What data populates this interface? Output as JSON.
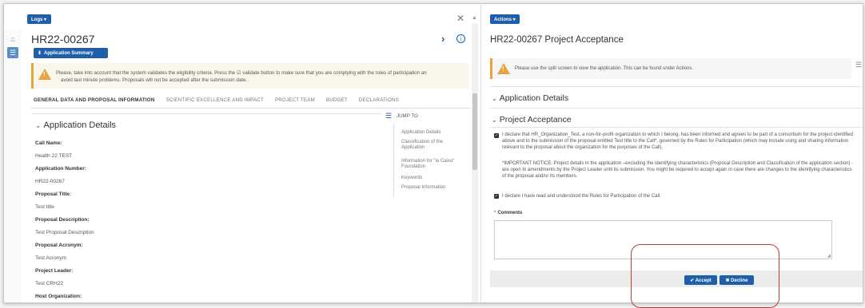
{
  "left": {
    "logs_button": "Logs ▾",
    "title": "HR22-00267",
    "summary_button": "Application Summary",
    "warning_line1": "Please, take into account that the system validates the eligibility criteria. Press the ☑ validate button to make sure that you are complying with the rules of participation an",
    "warning_line2": "avoid last minute problems. Proposals will not be accepted after the submission date.",
    "tabs": [
      {
        "label": "GENERAL DATA AND PROPOSAL INFORMATION"
      },
      {
        "label": "SCIENTIFIC EXCELLENCE AND IMPACT"
      },
      {
        "label": "PROJECT TEAM"
      },
      {
        "label": "BUDGET"
      },
      {
        "label": "DECLARATIONS"
      }
    ],
    "section_title": "Application Details",
    "fields": [
      {
        "label": "Call Name:",
        "value": "Health 22 TEST"
      },
      {
        "label": "Application Number:",
        "value": "HR22-00267"
      },
      {
        "label": "Proposal Title:",
        "value": "Test title"
      },
      {
        "label": "Proposal Description:",
        "value": "Test Proposal Description"
      },
      {
        "label": "Proposal Acronym:",
        "value": "Test Acronym"
      },
      {
        "label": "Project Leader:",
        "value": "Test CRH22"
      },
      {
        "label": "Host Organization:",
        "value": ""
      }
    ],
    "jump_to": "JUMP TO",
    "jump_items": [
      {
        "label": "Application Details"
      },
      {
        "label": "Classification of the Application"
      },
      {
        "label": "Information for \"la Caixa\" Foundation"
      },
      {
        "label": "Keywords"
      },
      {
        "label": "Proposal Information"
      }
    ]
  },
  "right": {
    "actions_button": "Actions ▾",
    "title": "HR22-00267 Project Acceptance",
    "warning": "Please use the split screen to view the application. This can be found under Actions.",
    "section1": "Application Details",
    "section2": "Project Acceptance",
    "declaration1": "I declare that HR_Organization_Test, a non-for-profit organization to which I belong, has been informed and agrees to be part of a consortium for the project identified above and to the submission of the proposal entitled Test title to the Call*, governed by the Rules for Participation (which may include using and sharing information relevant to the proposal about the organization for the purposes of the Call).",
    "notice": "*IMPORTANT NOTICE: Project details in the application –excluding the identifying characteristics (Proposal Description and Classification of the application section) - are open to amendments by the Project Leader until its submission. You might be required to accept again in case there are changes to the identifying characteristics of the proposal and/or its members.",
    "declaration2": "I declare I have read and understood the Rules for Participation of the Call.",
    "comments_label": "Comments",
    "accept": "✔ Accept",
    "decline": "✖ Decline"
  }
}
